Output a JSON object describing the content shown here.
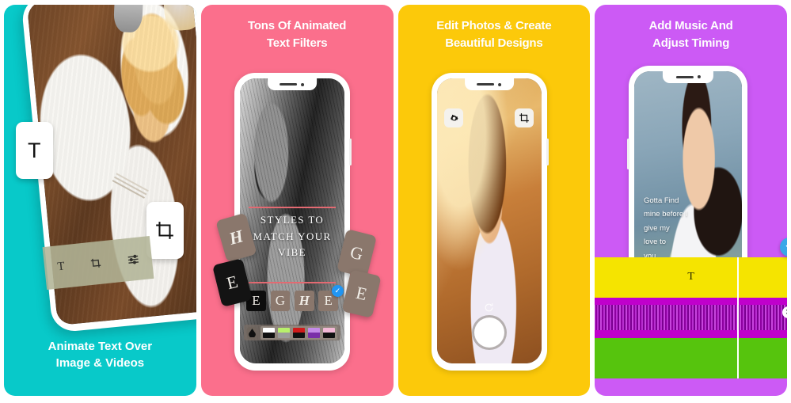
{
  "app_store_gallery": {
    "panels": [
      {
        "id": "panel-animate-text",
        "background_color": "#08C9C9",
        "caption_lines": [
          "Animate Text Over",
          "Image & Videos"
        ],
        "floating_buttons": [
          {
            "name": "text-tool-button",
            "glyph": "T"
          },
          {
            "name": "crop-tool-button",
            "glyph": "crop-icon"
          }
        ],
        "toolbar_items": [
          {
            "name": "text-icon",
            "glyph": "T"
          },
          {
            "name": "crop-icon",
            "glyph": "crop"
          },
          {
            "name": "adjust-sliders-icon",
            "glyph": "sliders"
          }
        ]
      },
      {
        "id": "panel-text-filters",
        "background_color": "#FB6F8C",
        "heading_lines": [
          "Tons Of Animated",
          "Text Filters"
        ],
        "preview_text_lines": [
          "STYLES TO",
          "MATCH YOUR",
          "VIBE"
        ],
        "floating_tiles": [
          {
            "name": "style-tile-h",
            "label": "H",
            "style": "taupe-script"
          },
          {
            "name": "style-tile-e-dark",
            "label": "E",
            "style": "dark-serif"
          },
          {
            "name": "style-tile-g",
            "label": "G",
            "style": "taupe-serif"
          },
          {
            "name": "style-tile-e",
            "label": "E",
            "style": "taupe-serif"
          }
        ],
        "filter_row": [
          {
            "name": "filter-option-e-dark",
            "label": "E",
            "selected": false,
            "style": "dark"
          },
          {
            "name": "filter-option-g",
            "label": "G",
            "selected": false,
            "style": "taupe"
          },
          {
            "name": "filter-option-h",
            "label": "H",
            "selected": false,
            "style": "taupe-script"
          },
          {
            "name": "filter-option-e",
            "label": "E",
            "selected": true,
            "style": "taupe"
          }
        ],
        "color_swatches": [
          {
            "name": "swatch-white-black",
            "top": "#FFFFFF",
            "bottom": "#111111"
          },
          {
            "name": "swatch-green-gray",
            "top": "#B8F06B",
            "bottom": "#9A9A9A"
          },
          {
            "name": "swatch-red-black",
            "top": "#D01B1B",
            "bottom": "#111111"
          },
          {
            "name": "swatch-purple-white",
            "top": "#C48BE8",
            "bottom": "#7A2FA8"
          },
          {
            "name": "swatch-pink-black",
            "top": "#F2B8D6",
            "bottom": "#111111"
          }
        ],
        "eyedropper_label": "droplet-icon",
        "check_glyph": "✓"
      },
      {
        "id": "panel-edit-photos",
        "background_color": "#FCC90A",
        "heading_lines": [
          "Edit Photos & Create",
          "Beautiful Designs"
        ],
        "controls": [
          {
            "name": "settings-gear-icon",
            "glyph": "gear"
          },
          {
            "name": "crop-icon",
            "glyph": "crop"
          },
          {
            "name": "flip-camera-icon",
            "glyph": "↻"
          },
          {
            "name": "shutter-button",
            "glyph": ""
          }
        ]
      },
      {
        "id": "panel-add-music",
        "background_color": "#CC5AF5",
        "heading_lines": [
          "Add Music And",
          "Adjust Timing"
        ],
        "overlay_text_lines": [
          "Gotta Find",
          "mine before I",
          "give my",
          "love to",
          "you"
        ],
        "timeline_tracks": [
          {
            "name": "timeline-track-text",
            "color": "#F5E400",
            "label": "T",
            "type": "text"
          },
          {
            "name": "timeline-track-audio",
            "color": "#C000CC",
            "label": "",
            "type": "waveform"
          },
          {
            "name": "timeline-track-video",
            "color": "#56C40D",
            "label": "",
            "type": "clip"
          }
        ],
        "timeline_controls": [
          {
            "name": "confirm-chevron-button",
            "glyph": "⌄",
            "color": "#39A8E8"
          },
          {
            "name": "remove-track-button",
            "glyph": "✕",
            "color": "#FFFFFF"
          }
        ],
        "playhead_position_pct": 70
      }
    ]
  }
}
